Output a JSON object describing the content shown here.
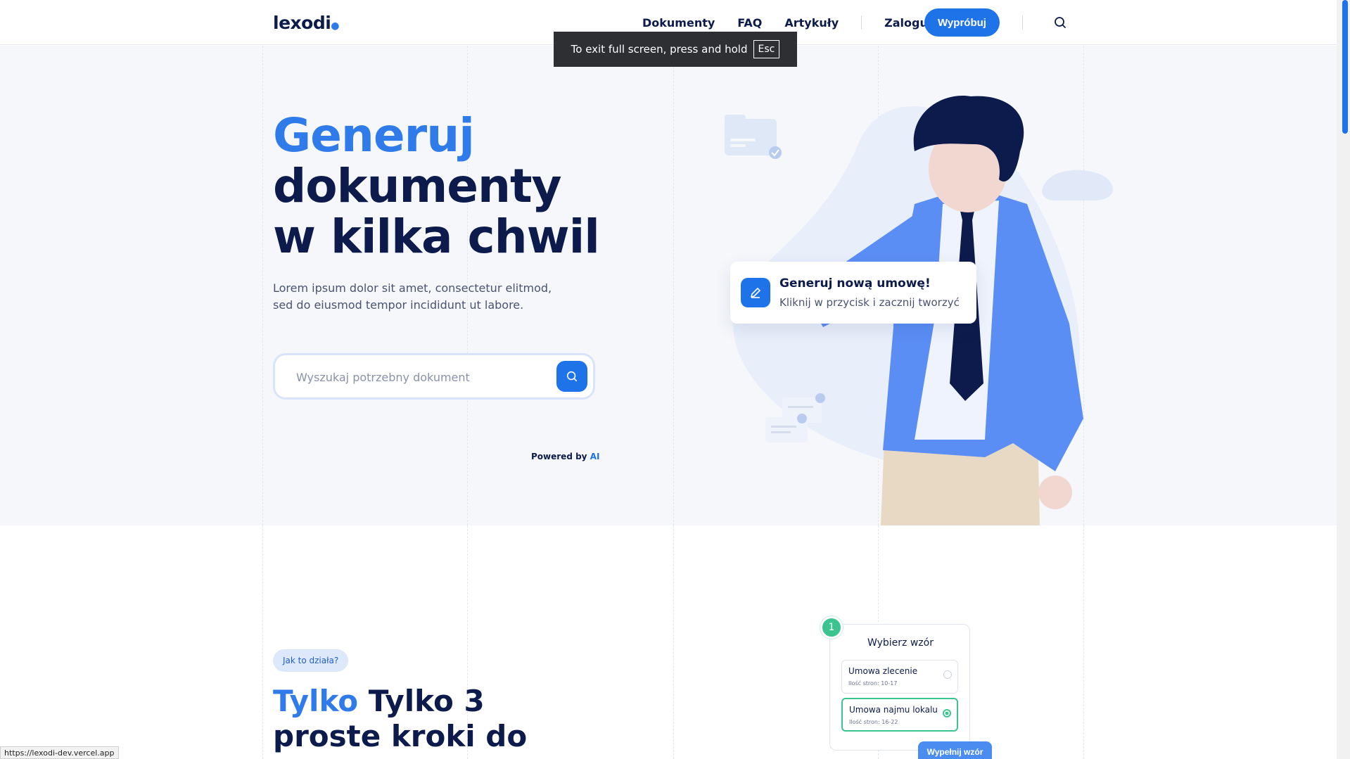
{
  "header": {
    "logo": "lexodi",
    "nav": [
      "Dokumenty",
      "FAQ",
      "Artykuły",
      "Zaloguj"
    ],
    "cta": "Wypróbuj"
  },
  "toast": {
    "text": "To exit full screen, press and hold",
    "key": "Esc"
  },
  "hero": {
    "title_accent": "Generuj",
    "title_line2": "dokumenty",
    "title_line3": "w kilka chwil",
    "lead_line1": "Lorem ipsum dolor sit amet, consectetur elitmod,",
    "lead_line2": "sed do eiusmod tempor incididunt ut labore.",
    "search_placeholder": "Wyszukaj potrzebny dokument",
    "powered_by": "Powered by",
    "powered_ai": "AI",
    "card_title": "Generuj nową umowę!",
    "card_text": "Kliknij w przycisk i zacznij tworzyć"
  },
  "how": {
    "pill": "Jak to działa?",
    "title_accent": "Tylko",
    "title_rest": "Tylko 3",
    "title_line2": "proste kroki do",
    "step_number": "1",
    "step_title": "Wybierz wzór",
    "options": [
      {
        "name": "Umowa zlecenie",
        "pages": "Ilość stron: 10-17",
        "selected": false
      },
      {
        "name": "Umowa najmu lokalu",
        "pages": "Ilość stron: 16-22",
        "selected": true
      }
    ],
    "fill_button": "Wypełnij wzór"
  },
  "status_url": "https://lexodi-dev.vercel.app",
  "colors": {
    "primary": "#1f73e8",
    "navy": "#0d1b4c",
    "accent": "#2f7bea",
    "success": "#3cc490"
  }
}
